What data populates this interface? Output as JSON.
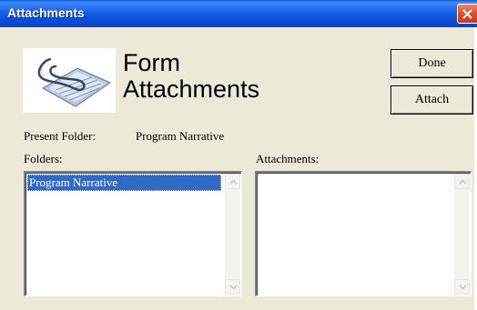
{
  "window": {
    "title": "Attachments"
  },
  "header": {
    "title_line1": "Form",
    "title_line2": "Attachments"
  },
  "buttons": {
    "done_label": "Done",
    "attach_label": "Attach"
  },
  "present_folder": {
    "label": "Present Folder:",
    "value": "Program Narrative"
  },
  "folders": {
    "label": "Folders:",
    "items": [
      "Program Narrative"
    ]
  },
  "attachments": {
    "label": "Attachments:",
    "items": []
  },
  "colors": {
    "titlebar": "#0a4fd6",
    "selection": "#316ac5",
    "dialog_bg": "#ece9d8",
    "close": "#d8502c"
  },
  "icons": {
    "logo": "paperclip-document-icon",
    "close": "close-icon"
  }
}
